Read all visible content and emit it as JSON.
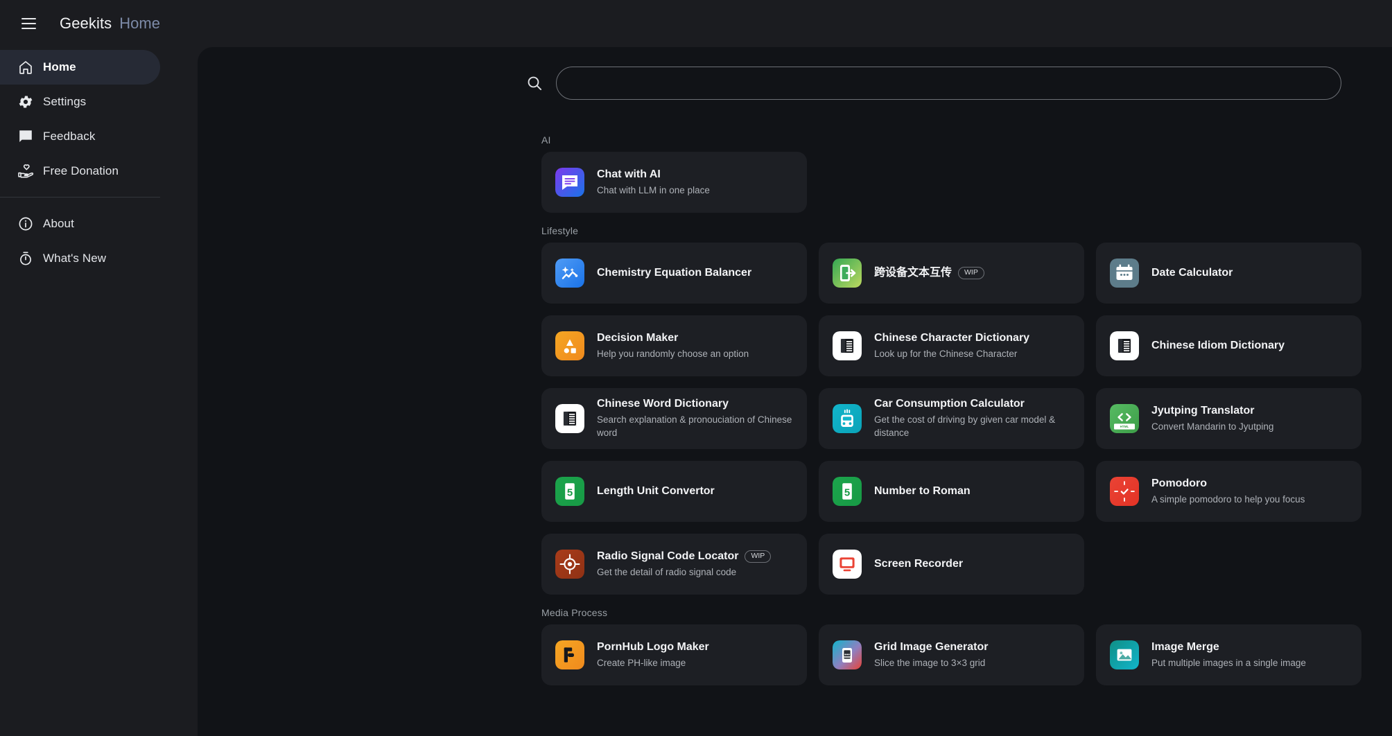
{
  "header": {
    "menu_icon": "hamburger-menu-icon",
    "brand": "Geekits",
    "page_label": "Home"
  },
  "sidebar": {
    "items": [
      {
        "label": "Home",
        "icon": "home-icon",
        "active": true
      },
      {
        "label": "Settings",
        "icon": "gear-icon",
        "active": false
      },
      {
        "label": "Feedback",
        "icon": "chat-lines-icon",
        "active": false
      },
      {
        "label": "Free Donation",
        "icon": "hand-heart-icon",
        "active": false
      }
    ],
    "items_secondary": [
      {
        "label": "About",
        "icon": "info-circle-icon",
        "active": false
      },
      {
        "label": "What's New",
        "icon": "stopwatch-icon",
        "active": false
      }
    ]
  },
  "search": {
    "icon": "search-icon",
    "value": "",
    "placeholder": ""
  },
  "sections": [
    {
      "title": "AI",
      "columns": 1,
      "cards": [
        {
          "title": "Chat with AI",
          "desc": "Chat with LLM in one place",
          "badge": "",
          "icon": "chat-bubble-icon",
          "icon_colors": [
            "#7c3aed",
            "#1a73e8"
          ]
        }
      ]
    },
    {
      "title": "Lifestyle",
      "columns": 3,
      "cards": [
        {
          "title": "Chemistry Equation Balancer",
          "desc": "",
          "badge": "",
          "icon": "sparkle-chart-icon",
          "icon_colors": [
            "#4f9bf5",
            "#1a73e8"
          ]
        },
        {
          "title": "跨设备文本互传",
          "desc": "",
          "badge": "WIP",
          "icon": "phone-transfer-icon",
          "icon_colors": [
            "#34a853",
            "#bdd860"
          ]
        },
        {
          "title": "Date Calculator",
          "desc": "",
          "badge": "",
          "icon": "calendar-icon",
          "icon_colors": [
            "#5d7c8a",
            "#5d7c8a"
          ]
        },
        {
          "title": "Decision Maker",
          "desc": "Help you randomly choose an option",
          "badge": "",
          "icon": "decision-shapes-icon",
          "icon_colors": [
            "#f5a623",
            "#f08a1d"
          ]
        },
        {
          "title": "Chinese Character Dictionary",
          "desc": "Look up for the Chinese Character",
          "badge": "",
          "icon": "book-icon",
          "icon_colors": [
            "#ffffff",
            "#ffffff"
          ]
        },
        {
          "title": "Chinese Idiom Dictionary",
          "desc": "",
          "badge": "",
          "icon": "book-icon",
          "icon_colors": [
            "#ffffff",
            "#ffffff"
          ]
        },
        {
          "title": "Chinese Word Dictionary",
          "desc": "Search explanation & pronouciation of Chinese word",
          "badge": "",
          "icon": "book-icon",
          "icon_colors": [
            "#ffffff",
            "#ffffff"
          ]
        },
        {
          "title": "Car Consumption Calculator",
          "desc": "Get the cost of driving by given car model & distance",
          "badge": "",
          "icon": "car-icon",
          "icon_colors": [
            "#12b5cb",
            "#0aa3b8"
          ]
        },
        {
          "title": "Jyutping Translator",
          "desc": "Convert Mandarin to Jyutping",
          "badge": "",
          "icon": "code-html-icon",
          "icon_colors": [
            "#57bb63",
            "#3d9e48"
          ]
        },
        {
          "title": "Length Unit Convertor",
          "desc": "",
          "badge": "",
          "icon": "ruler-s-icon",
          "icon_colors": [
            "#1ca44c",
            "#179a45"
          ]
        },
        {
          "title": "Number to Roman",
          "desc": "",
          "badge": "",
          "icon": "ruler-s-icon",
          "icon_colors": [
            "#1ca44c",
            "#179a45"
          ]
        },
        {
          "title": "Pomodoro",
          "desc": "A simple pomodoro to help you focus",
          "badge": "",
          "icon": "tomato-timer-icon",
          "icon_colors": [
            "#ea4335",
            "#e33325"
          ]
        },
        {
          "title": "Radio Signal Code Locator",
          "desc": "Get the detail of radio signal code",
          "badge": "WIP",
          "icon": "radio-target-icon",
          "icon_colors": [
            "#a93c1a",
            "#8f3114"
          ]
        },
        {
          "title": "Screen Recorder",
          "desc": "",
          "badge": "",
          "icon": "monitor-record-icon",
          "icon_colors": [
            "#ffffff",
            "#f2f2f2"
          ]
        }
      ]
    },
    {
      "title": "Media Process",
      "columns": 3,
      "cards": [
        {
          "title": "PornHub Logo Maker",
          "desc": "Create PH-like image",
          "badge": "",
          "icon": "ph-logo-icon",
          "icon_colors": [
            "#f5a623",
            "#f08a1d"
          ]
        },
        {
          "title": "Grid Image Generator",
          "desc": "Slice the image to 3×3 grid",
          "badge": "",
          "icon": "grid-phone-icon",
          "icon_colors": [
            "#12b5cb",
            "#ea4335"
          ]
        },
        {
          "title": "Image Merge",
          "desc": "Put multiple images in a single image",
          "badge": "",
          "icon": "image-icon",
          "icon_colors": [
            "#0f8f86",
            "#12b5cb"
          ]
        }
      ]
    }
  ],
  "colors": {
    "app_bg": "#1b1c20",
    "main_bg": "#111317",
    "card_bg": "#1d1f24",
    "active_nav": "#262a35",
    "accent_link": "#7d8ba8"
  }
}
